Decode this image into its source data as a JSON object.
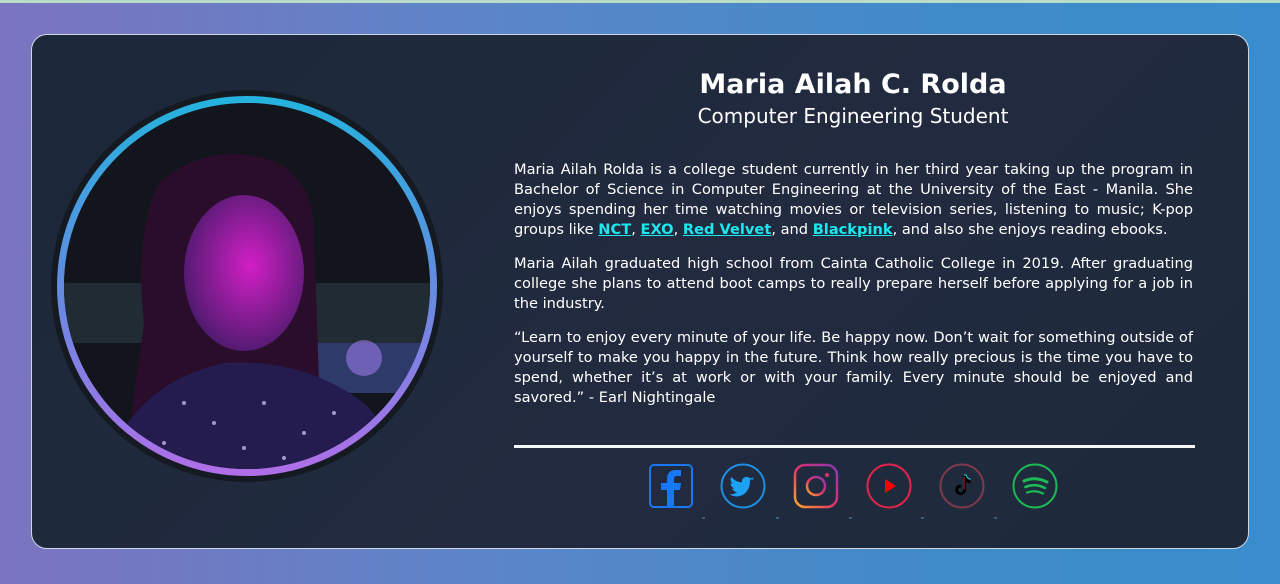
{
  "profile": {
    "name": "Maria Ailah C. Rolda",
    "title": "Computer Engineering Student"
  },
  "bio": {
    "p1_before_links": "Maria Ailah Rolda is a college student currently in her third year taking up the program in Bachelor of Science in Computer Engineering at the University of the East - Manila. She enjoys spending her time watching movies or television series, listening to music; K-pop groups like ",
    "links": [
      "NCT",
      "EXO",
      "Red Velvet",
      "Blackpink"
    ],
    "sep1": ", ",
    "sep2": ", ",
    "sep3": ", and ",
    "p1_after_links": ", and also she enjoys reading ebooks.",
    "p2": "Maria Ailah graduated high school from Cainta Catholic College in 2019. After graduating college she plans to attend boot camps to really prepare herself before applying for a job in the industry.",
    "quote": "“Learn to enjoy every minute of your life. Be happy now. Don’t wait for something outside of yourself to make you happy in the future. Think how really precious is the time you have to spend, whether it’s at work or with your family. Every minute should be enjoyed and savored.” - Earl Nightingale"
  },
  "socials": [
    {
      "icon": "facebook-icon",
      "color": "#1877f2"
    },
    {
      "icon": "twitter-icon",
      "color": "#1da1f2"
    },
    {
      "icon": "instagram-icon",
      "color": "#e1306c"
    },
    {
      "icon": "youtube-icon",
      "color": "#ff0000"
    },
    {
      "icon": "tiktok-icon",
      "color": "#ff0050"
    },
    {
      "icon": "spotify-icon",
      "color": "#1db954"
    }
  ],
  "colors": {
    "card_bg": "#1f2a3c",
    "link": "#1ee6ef",
    "ring_top": "#24b3de",
    "ring_bottom": "#b06ee8"
  }
}
